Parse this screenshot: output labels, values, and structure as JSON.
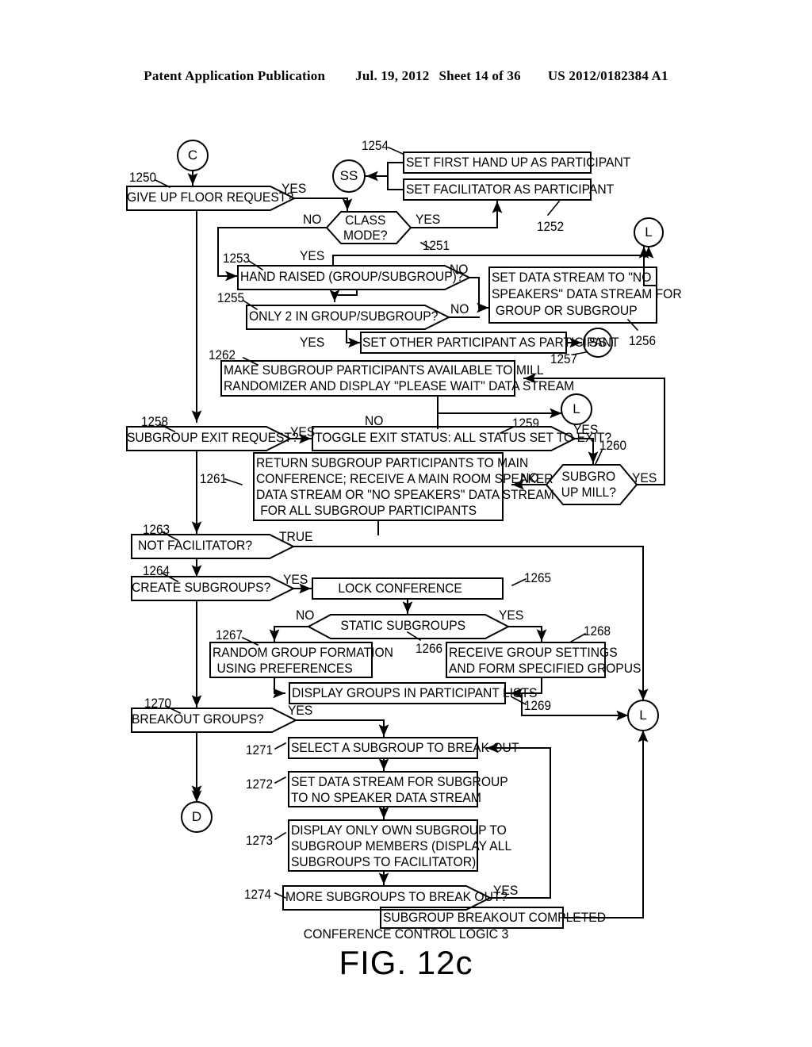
{
  "header": {
    "publication": "Patent Application Publication",
    "date": "Jul. 19, 2012",
    "sheet": "Sheet 14 of 36",
    "docnum": "US 2012/0182384 A1"
  },
  "figure": {
    "logic_title": "CONFERENCE CONTROL LOGIC 3",
    "label": "FIG. 12c"
  },
  "connectors": {
    "c_in": "C",
    "d_out": "D",
    "ss_1": "SS",
    "ss_2": "SS",
    "l_1": "L",
    "l_2": "L",
    "l_3": "L"
  },
  "nodes": {
    "n1250": {
      "ref": "1250",
      "text": "GIVE UP FLOOR REQUEST?",
      "shape": "decision"
    },
    "n1251": {
      "ref": "1251",
      "text": "CLASS MODE?",
      "line1": "CLASS",
      "line2": "MODE?",
      "shape": "hexagon"
    },
    "n1254": {
      "ref": "1254",
      "text": "SET FIRST HAND UP AS PARTICIPANT",
      "shape": "process"
    },
    "n1252": {
      "ref": "1252",
      "text": "SET FACILITATOR AS PARTICIPANT",
      "shape": "process"
    },
    "n1253": {
      "ref": "1253",
      "text": "HAND RAISED (GROUP/SUBGROUP)?",
      "shape": "decision"
    },
    "n1255": {
      "ref": "1255",
      "text": "ONLY 2 IN GROUP/SUBGROUP?",
      "shape": "decision"
    },
    "n1256": {
      "ref": "1256",
      "line1": "SET DATA STREAM TO \"NO",
      "line2": "SPEAKERS\" DATA STREAM FOR",
      "line3": "GROUP OR SUBGROUP",
      "shape": "process"
    },
    "n1257": {
      "ref": "1257",
      "text": "SET OTHER PARTICIPANT AS PARTICIPANT",
      "shape": "process"
    },
    "n1262": {
      "ref": "1262",
      "line1": "MAKE SUBGROUP PARTICIPANTS AVAILABLE TO MILL",
      "line2": "RANDOMIZER AND DISPLAY \"PLEASE WAIT\" DATA STREAM",
      "shape": "process"
    },
    "n1258": {
      "ref": "1258",
      "text": "SUBGROUP EXIT REQUEST?",
      "shape": "decision"
    },
    "n1259": {
      "ref": "1259",
      "text": "TOGGLE EXIT STATUS:  ALL STATUS SET TO EXIT?",
      "shape": "decision"
    },
    "n1260": {
      "ref": "1260",
      "line1": "SUBGRO",
      "line2": "UP MILL?",
      "shape": "hexagon"
    },
    "n1261": {
      "ref": "1261",
      "line1": "RETURN SUBGROUP PARTICIPANTS TO MAIN",
      "line2": "CONFERENCE; RECEIVE A MAIN ROOM SPEAKER",
      "line3": "DATA STREAM OR \"NO SPEAKERS\" DATA STREAM",
      "line4": "FOR ALL SUBGROUP PARTICIPANTS",
      "shape": "process"
    },
    "n1263": {
      "ref": "1263",
      "text": "NOT FACILITATOR?",
      "shape": "decision"
    },
    "n1264": {
      "ref": "1264",
      "text": "CREATE SUBGROUPS?",
      "shape": "decision"
    },
    "n1265": {
      "ref": "1265",
      "text": "LOCK CONFERENCE",
      "shape": "process"
    },
    "n1266": {
      "ref": "1266",
      "text": "STATIC SUBGROUPS",
      "shape": "decision"
    },
    "n1267": {
      "ref": "1267",
      "line1": "RANDOM GROUP FORMATION",
      "line2": "USING PREFERENCES",
      "shape": "process"
    },
    "n1268": {
      "ref": "1268",
      "line1": "RECEIVE GROUP SETTINGS",
      "line2": "AND FORM SPECIFIED GROPUS",
      "shape": "process"
    },
    "n1269": {
      "ref": "1269",
      "text": "DISPLAY GROUPS IN PARTICIPANT LISTS",
      "shape": "process"
    },
    "n1270": {
      "ref": "1270",
      "text": "BREAKOUT GROUPS?",
      "shape": "decision"
    },
    "n1271": {
      "ref": "1271",
      "text": "SELECT A SUBGROUP TO BREAK OUT",
      "shape": "process"
    },
    "n1272": {
      "ref": "1272",
      "line1": "SET DATA STREAM FOR SUBGROUP",
      "line2": "TO NO SPEAKER DATA STREAM",
      "shape": "process"
    },
    "n1273": {
      "ref": "1273",
      "line1": "DISPLAY ONLY OWN SUBGROUP TO",
      "line2": "SUBGROUP MEMBERS (DISPLAY ALL",
      "line3": "SUBGROUPS TO FACILITATOR)",
      "shape": "process"
    },
    "n1274": {
      "ref": "1274",
      "text": "MORE SUBGROUPS TO BREAK OUT?",
      "shape": "decision"
    },
    "n1275": {
      "text": "SUBGROUP BREAKOUT COMPLETED",
      "shape": "process"
    }
  },
  "edge_labels": {
    "e1250_yes": "YES",
    "e1251_no": "NO",
    "e1251_yes": "YES",
    "e1253_yes": "YES",
    "e1253_no": "NO",
    "e1255_no": "NO",
    "e1255_yes": "YES",
    "e1258_yes": "YES",
    "e1259_no": "NO",
    "e1259_yes": "YES",
    "e1260_no": "NO",
    "e1260_yes": "YES",
    "e1263_true": "TRUE",
    "e1264_yes": "YES",
    "e1266_no": "NO",
    "e1266_yes": "YES",
    "e1270_yes": "YES",
    "e1274_yes": "YES"
  }
}
